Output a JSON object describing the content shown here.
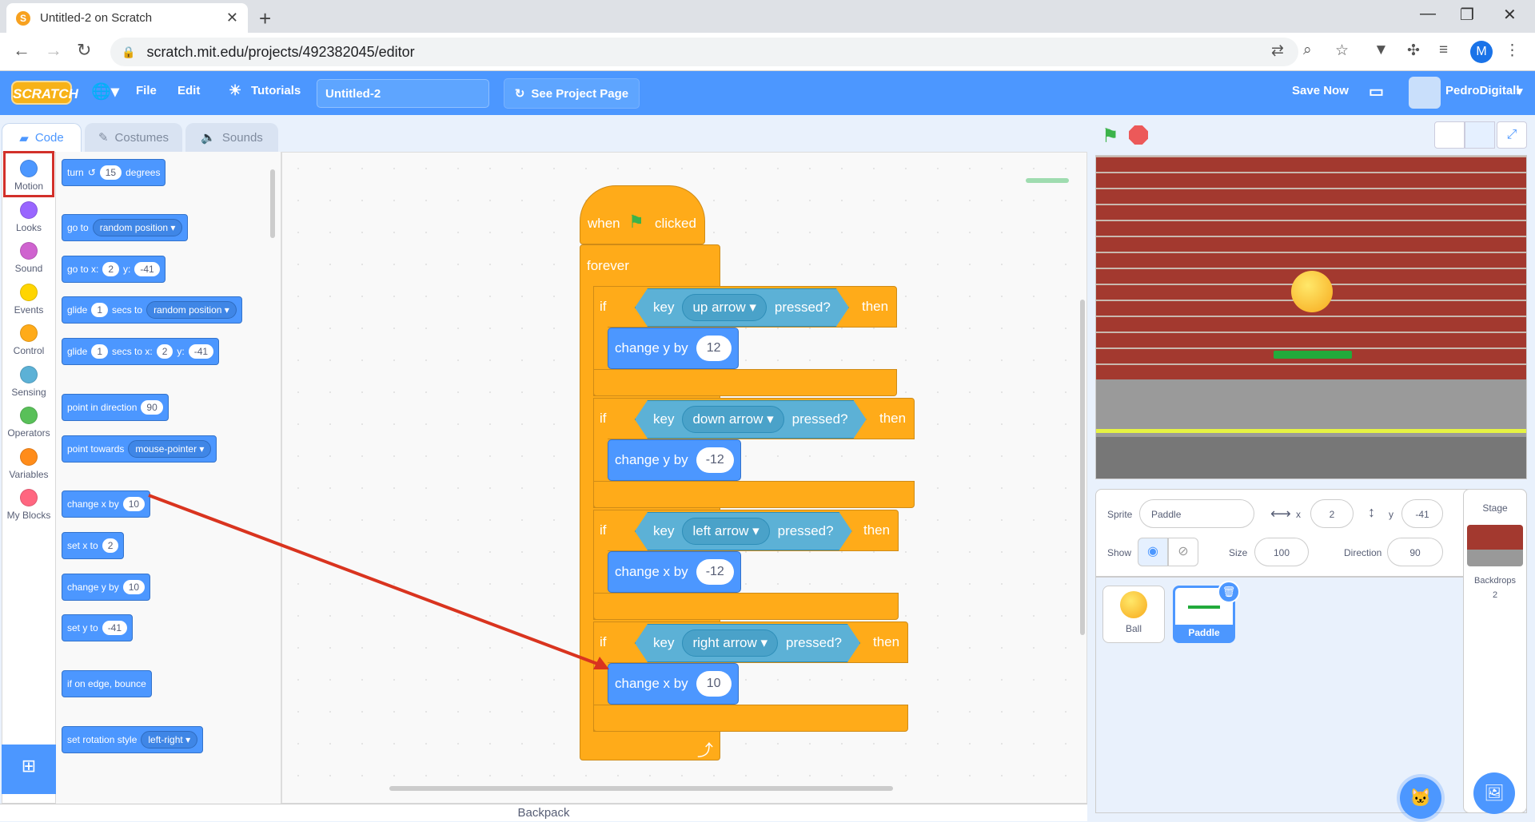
{
  "browser": {
    "tab_title": "Untitled-2 on Scratch",
    "tab_favicon": "S",
    "url": "scratch.mit.edu/projects/492382045/editor",
    "profile_initial": "M"
  },
  "menu": {
    "logo": "SCRATCH",
    "file": "File",
    "edit": "Edit",
    "tutorials": "Tutorials",
    "project_title": "Untitled-2",
    "see_project_page": "See Project Page",
    "save_now": "Save Now",
    "username": "PedroDigitall"
  },
  "tabs": {
    "code": "Code",
    "costumes": "Costumes",
    "sounds": "Sounds"
  },
  "categories": [
    {
      "label": "Motion",
      "color": "#4c97ff"
    },
    {
      "label": "Looks",
      "color": "#9966ff"
    },
    {
      "label": "Sound",
      "color": "#cf63cf"
    },
    {
      "label": "Events",
      "color": "#ffd500"
    },
    {
      "label": "Control",
      "color": "#ffab19"
    },
    {
      "label": "Sensing",
      "color": "#5cb1d6"
    },
    {
      "label": "Operators",
      "color": "#59c059"
    },
    {
      "label": "Variables",
      "color": "#ff8c1a"
    },
    {
      "label": "My Blocks",
      "color": "#ff6680"
    }
  ],
  "palette": {
    "turn": {
      "a": "turn",
      "v": "15",
      "b": "degrees"
    },
    "goto": {
      "a": "go to",
      "dd": "random position"
    },
    "gotoxy": {
      "a": "go to x:",
      "x": "2",
      "b": "y:",
      "y": "-41"
    },
    "glide1": {
      "a": "glide",
      "v": "1",
      "b": "secs to",
      "dd": "random position"
    },
    "glide2": {
      "a": "glide",
      "v": "1",
      "b": "secs to x:",
      "x": "2",
      "c": "y:",
      "y": "-41"
    },
    "point": {
      "a": "point in direction",
      "v": "90"
    },
    "towards": {
      "a": "point towards",
      "dd": "mouse-pointer"
    },
    "changex": {
      "a": "change x by",
      "v": "10"
    },
    "setx": {
      "a": "set x to",
      "v": "2"
    },
    "changey": {
      "a": "change y by",
      "v": "10"
    },
    "sety": {
      "a": "set y to",
      "v": "-41"
    },
    "bounce": {
      "a": "if on edge, bounce"
    },
    "rotation": {
      "a": "set rotation style",
      "dd": "left-right"
    }
  },
  "script": {
    "when": "when",
    "clicked": "clicked",
    "forever": "forever",
    "if_label": "if",
    "key": "key",
    "pressed": "pressed?",
    "then": "then",
    "ifs": [
      {
        "key": "up arrow",
        "action": "change y by",
        "value": "12"
      },
      {
        "key": "down arrow",
        "action": "change y by",
        "value": "-12"
      },
      {
        "key": "left arrow",
        "action": "change x by",
        "value": "-12"
      },
      {
        "key": "right arrow",
        "action": "change x by",
        "value": "10"
      }
    ]
  },
  "sprite_info": {
    "sprite_label": "Sprite",
    "sprite_name": "Paddle",
    "x_label": "x",
    "x": "2",
    "y_label": "y",
    "y": "-41",
    "show_label": "Show",
    "size_label": "Size",
    "size": "100",
    "direction_label": "Direction",
    "direction": "90"
  },
  "sprites": [
    {
      "name": "Ball"
    },
    {
      "name": "Paddle"
    }
  ],
  "stage_pane": {
    "title": "Stage",
    "backdrops_label": "Backdrops",
    "backdrops_count": "2"
  },
  "backpack": "Backpack"
}
